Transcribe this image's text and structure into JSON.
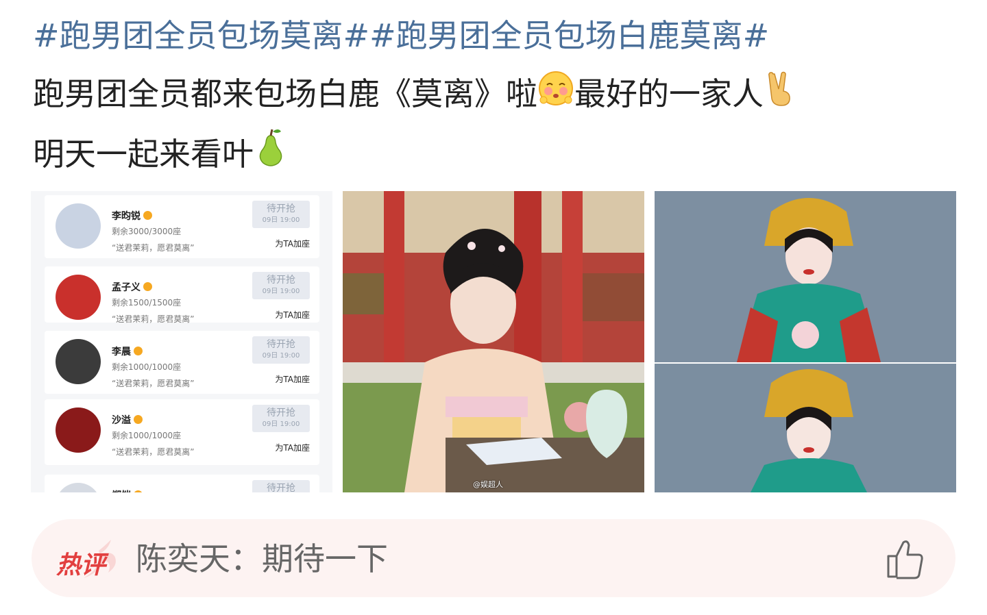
{
  "post": {
    "hashtag1": "#跑男团全员包场莫离#",
    "hashtag2": "#跑男团全员包场白鹿莫离#",
    "body_line1": "跑男团全员都来包场白鹿《莫离》啦",
    "body_after_emoji": "最好的一家人",
    "body_line3": "明天一起来看叶",
    "emojis": [
      "shy-face-emoji",
      "victory-hand-emoji",
      "pear-emoji"
    ]
  },
  "tickets": [
    {
      "name": "李昀锐",
      "seats": "剩余3000/3000座",
      "quote": "“送君茉莉，愿君莫离”",
      "status": "待开抢",
      "time": "09日 19:00",
      "action": "为TA加座",
      "avatar_color": "#c9d3e3"
    },
    {
      "name": "孟子义",
      "seats": "剩余1500/1500座",
      "quote": "“送君茉莉，愿君莫离”",
      "status": "待开抢",
      "time": "09日 19:00",
      "action": "为TA加座",
      "avatar_color": "#c9302c"
    },
    {
      "name": "李晨",
      "seats": "剩余1000/1000座",
      "quote": "“送君茉莉，愿君莫离”",
      "status": "待开抢",
      "time": "09日 19:00",
      "action": "为TA加座",
      "avatar_color": "#3b3b3b"
    },
    {
      "name": "沙溢",
      "seats": "剩余1000/1000座",
      "quote": "“送君茉莉，愿君莫离”",
      "status": "待开抢",
      "time": "09日 19:00",
      "action": "为TA加座",
      "avatar_color": "#8a1a1a"
    },
    {
      "name": "郑恺",
      "status": "待开抢",
      "avatar_color": "#d6dbe3"
    }
  ],
  "image2": {
    "watermark": "@娱超人"
  },
  "hot_comment": {
    "badge": "热评",
    "author": "陈奕天",
    "separator": "：",
    "text": "期待一下"
  },
  "colors": {
    "hashtag": "#4a6f99",
    "hot_badge": "#e23f3f",
    "comment_bg": "#fdf3f2"
  }
}
